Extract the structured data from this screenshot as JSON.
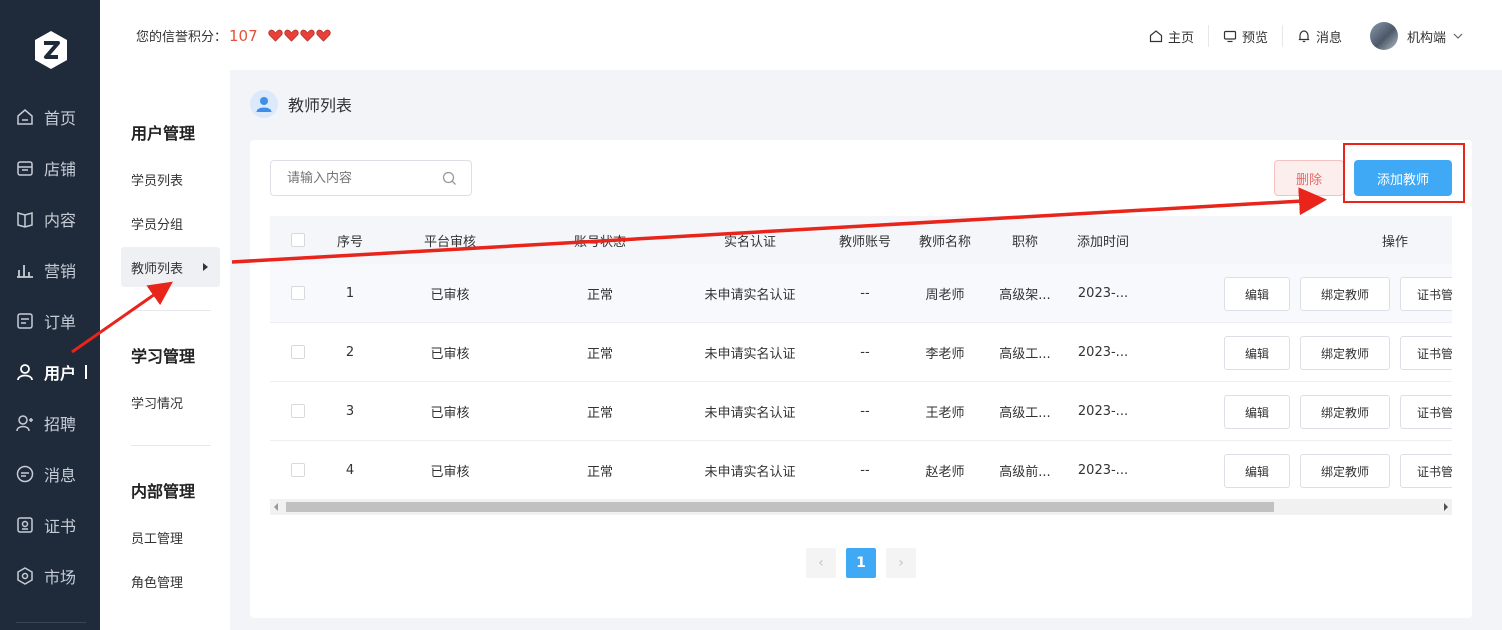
{
  "header": {
    "credit_label": "您的信誉积分：",
    "credit_score": "107",
    "links": {
      "home": "主页",
      "preview": "预览",
      "messages": "消息"
    },
    "user_name": "机构端"
  },
  "sidebar": {
    "items": [
      {
        "label": "首页",
        "icon": "home-icon"
      },
      {
        "label": "店铺",
        "icon": "shop-icon"
      },
      {
        "label": "内容",
        "icon": "book-icon"
      },
      {
        "label": "营销",
        "icon": "chart-icon"
      },
      {
        "label": "订单",
        "icon": "order-icon"
      },
      {
        "label": "用户",
        "icon": "user-icon"
      },
      {
        "label": "招聘",
        "icon": "recruit-icon"
      },
      {
        "label": "消息",
        "icon": "message-icon"
      },
      {
        "label": "证书",
        "icon": "certificate-icon"
      },
      {
        "label": "市场",
        "icon": "market-icon"
      }
    ]
  },
  "subnav": {
    "groups": [
      {
        "title": "用户管理",
        "items": [
          "学员列表",
          "学员分组",
          "教师列表"
        ]
      },
      {
        "title": "学习管理",
        "items": [
          "学习情况"
        ]
      },
      {
        "title": "内部管理",
        "items": [
          "员工管理",
          "角色管理"
        ]
      }
    ]
  },
  "page": {
    "title": "教师列表"
  },
  "toolbar": {
    "search_placeholder": "请输入内容",
    "delete_label": "删除",
    "add_label": "添加教师"
  },
  "table": {
    "headers": [
      "序号",
      "平台审核",
      "账号状态",
      "实名认证",
      "教师账号",
      "教师名称",
      "职称",
      "添加时间",
      "操作"
    ],
    "rows": [
      {
        "no": "1",
        "audit": "已审核",
        "status": "正常",
        "realname": "未申请实名认证",
        "account": "--",
        "name": "周老师",
        "title": "高级架...",
        "time": "2023-..."
      },
      {
        "no": "2",
        "audit": "已审核",
        "status": "正常",
        "realname": "未申请实名认证",
        "account": "--",
        "name": "李老师",
        "title": "高级工...",
        "time": "2023-..."
      },
      {
        "no": "3",
        "audit": "已审核",
        "status": "正常",
        "realname": "未申请实名认证",
        "account": "--",
        "name": "王老师",
        "title": "高级工...",
        "time": "2023-..."
      },
      {
        "no": "4",
        "audit": "已审核",
        "status": "正常",
        "realname": "未申请实名认证",
        "account": "--",
        "name": "赵老师",
        "title": "高级前...",
        "time": "2023-..."
      }
    ],
    "ops": {
      "edit": "编辑",
      "bind": "绑定教师",
      "cert": "证书管"
    }
  },
  "pagination": {
    "prev": "‹",
    "current": "1",
    "next": "›"
  },
  "colors": {
    "accent": "#3fa9f5",
    "sidebar_bg": "#1f2a3a",
    "score": "#e8503a",
    "annotation": "#e8241b"
  }
}
